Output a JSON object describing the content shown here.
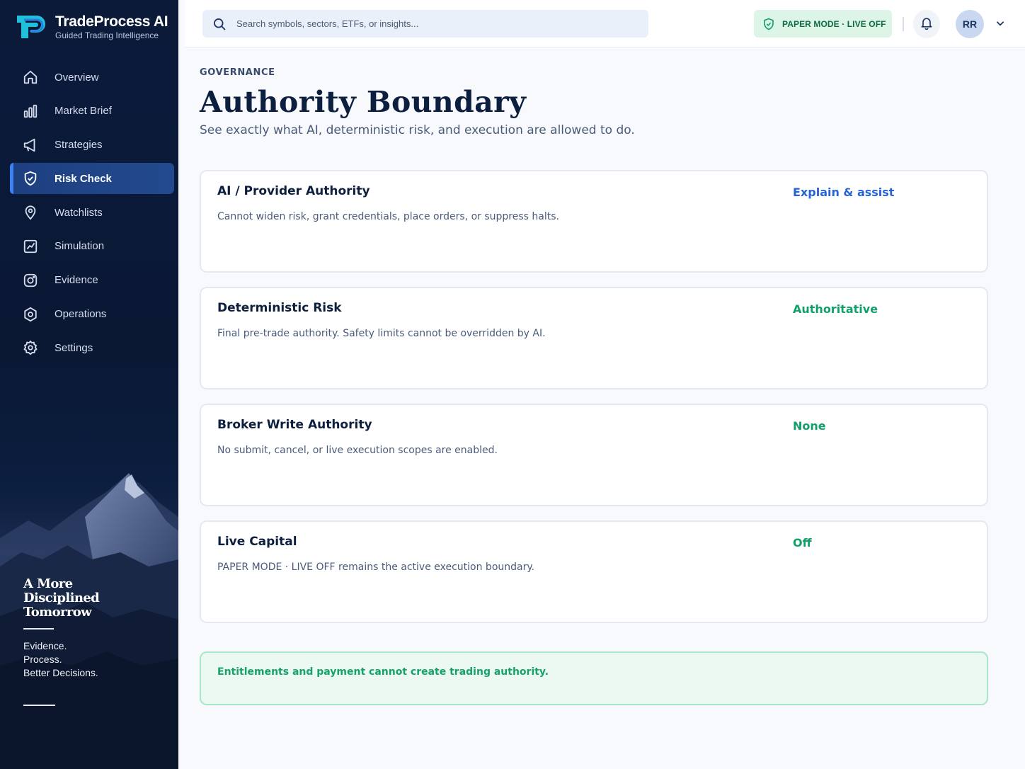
{
  "brand": {
    "name": "TradeProcess AI",
    "tagline": "Guided Trading Intelligence"
  },
  "nav": {
    "items": [
      {
        "label": "Overview",
        "icon": "home-icon"
      },
      {
        "label": "Market Brief",
        "icon": "bar-chart-icon"
      },
      {
        "label": "Strategies",
        "icon": "megaphone-icon"
      },
      {
        "label": "Risk Check",
        "icon": "shield-check-icon",
        "active": true
      },
      {
        "label": "Watchlists",
        "icon": "location-pin-icon"
      },
      {
        "label": "Simulation",
        "icon": "simulation-chart-icon"
      },
      {
        "label": "Evidence",
        "icon": "camera-icon"
      },
      {
        "label": "Operations",
        "icon": "hexagon-icon"
      },
      {
        "label": "Settings",
        "icon": "gear-icon"
      }
    ]
  },
  "motto": {
    "title_line1": "A More",
    "title_line2": "Disciplined",
    "title_line3": "Tomorrow",
    "line1": "Evidence.",
    "line2": "Process.",
    "line3": "Better Decisions."
  },
  "topbar": {
    "search_placeholder": "Search symbols, sectors, ETFs, or insights...",
    "mode_badge": "PAPER MODE · LIVE OFF",
    "avatar_initials": "RR"
  },
  "page": {
    "eyebrow": "GOVERNANCE",
    "title": "Authority Boundary",
    "subtitle": "See exactly what AI, deterministic risk, and execution are allowed to do."
  },
  "cards": [
    {
      "title": "AI / Provider Authority",
      "description": "Cannot widen risk, grant credentials, place orders, or suppress halts.",
      "value": "Explain & assist",
      "value_color": "#2563d6"
    },
    {
      "title": "Deterministic Risk",
      "description": "Final pre-trade authority. Safety limits cannot be overridden by AI.",
      "value": "Authoritative",
      "value_color": "#12a06a"
    },
    {
      "title": "Broker Write Authority",
      "description": "No submit, cancel, or live execution scopes are enabled.",
      "value": "None",
      "value_color": "#12a06a"
    },
    {
      "title": "Live Capital",
      "description": "PAPER MODE · LIVE OFF remains the active execution boundary.",
      "value": "Off",
      "value_color": "#12a06a"
    }
  ],
  "note": {
    "text": "Entitlements and payment cannot create trading authority."
  },
  "colors": {
    "accent_blue": "#2563d6",
    "success_green": "#12a06a",
    "sidebar_navy": "#0b1b3c"
  }
}
